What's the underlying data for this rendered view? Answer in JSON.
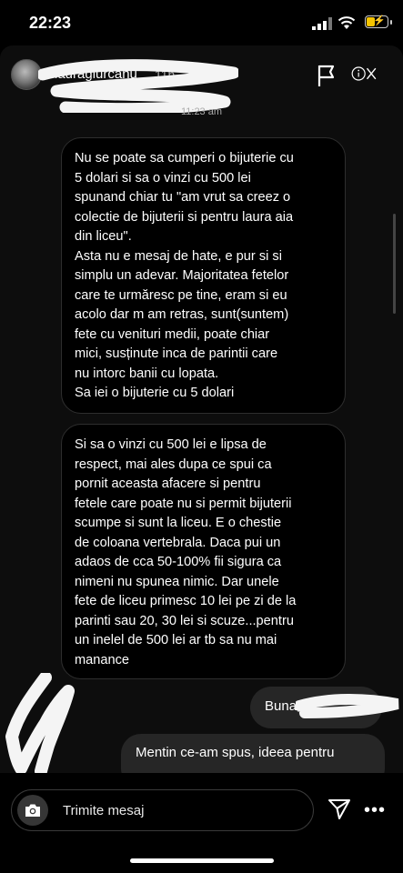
{
  "status": {
    "time": "22:23",
    "battery_level": 0.45,
    "battery_color": "#f5c400"
  },
  "header": {
    "username": "lauragiurcanu",
    "ago": "11h"
  },
  "timestamp": "11:23 am",
  "messages": [
    {
      "text": "Nu se poate sa cumperi o bijuterie cu\n5 dolari si sa o vinzi cu 500 lei\nspunand chiar tu \"am vrut sa creez o\ncolectie de bijuterii si pentru laura aia\ndin liceu\".\nAsta nu e mesaj de hate, e pur si si\nsimplu un adevar. Majoritatea fetelor\ncare te urmăresc pe tine, eram si eu\nacolo dar m am retras, sunt(suntem)\nfete cu venituri medii, poate chiar\nmici, susținute inca de parintii care\nnu intorc banii cu lopata.\nSa iei o bijuterie cu 5 dolari"
    },
    {
      "text": "Si sa o vinzi cu 500 lei e lipsa de\nrespect, mai ales dupa ce spui ca\npornit aceasta afacere si pentru\nfetele care poate nu si permit bijuterii\nscumpe si sunt la liceu. E o chestie\nde coloana vertebrala. Daca pui un\nadaos de cca 50-100% fii sigura ca\nnimeni nu spunea nimic. Dar unele\nfete de liceu primesc 10 lei pe zi de la\nparinti sau 20, 30 lei si scuze...pentru\nun inelel de 500 lei ar tb sa nu mai\nmanance"
    }
  ],
  "sent_messages": [
    {
      "text": "Buna,"
    },
    {
      "text": "Mentin ce-am spus, ideea pentru"
    }
  ],
  "composer": {
    "placeholder": "Trimite mesaj"
  },
  "icons": [
    "camera-icon",
    "send-icon",
    "more-icon",
    "flag-icon",
    "close-icon",
    "avatar"
  ]
}
